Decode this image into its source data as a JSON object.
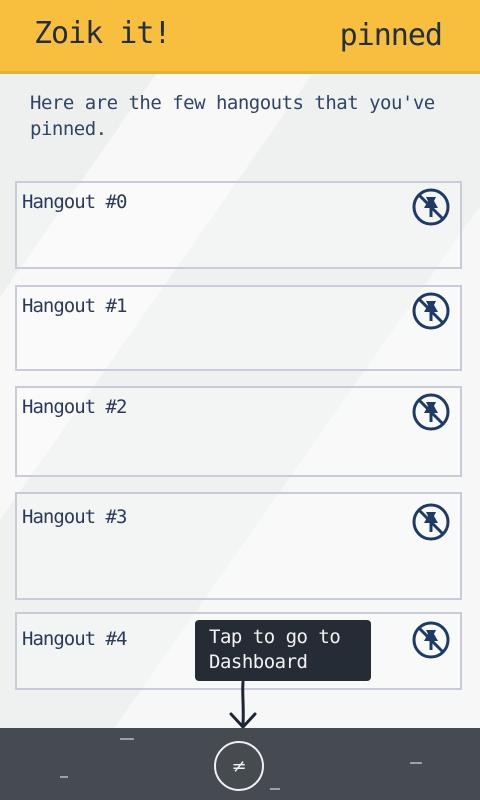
{
  "header": {
    "app_title": "Zoik it!",
    "page_label": "pinned"
  },
  "intro": "Here are the few hangouts that you've pinned.",
  "hangouts": [
    {
      "name": "Hangout #0"
    },
    {
      "name": "Hangout #1"
    },
    {
      "name": "Hangout #2"
    },
    {
      "name": "Hangout #3"
    },
    {
      "name": "Hangout #4"
    }
  ],
  "tooltip": {
    "text_line1": "Tap to go to",
    "text_line2": "Dashboard"
  },
  "footer": {
    "dashboard_glyph": "≠"
  },
  "icons": {
    "unpin": "unpin-icon",
    "dashboard": "zoik-logo-icon",
    "pointer": "hand-drawn-arrow-icon"
  },
  "colors": {
    "header": "#f8bf3e",
    "footer": "#464b52",
    "accent_text": "#2b3a59",
    "tooltip_bg": "#262c36"
  }
}
